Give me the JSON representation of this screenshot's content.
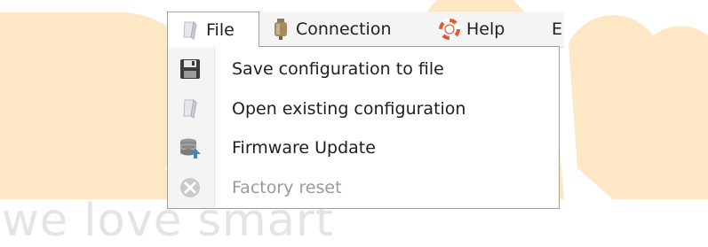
{
  "background": {
    "tagline": "we love smart",
    "logo_color": "#fde7c4",
    "tagline_color": "#e4e4e4"
  },
  "menubar": {
    "items": [
      {
        "label": "File",
        "icon": "file-icon"
      },
      {
        "label": "Connection",
        "icon": "connection-plug-icon"
      },
      {
        "label": "Help",
        "icon": "lifebuoy-icon"
      },
      {
        "label": "E",
        "icon": ""
      }
    ]
  },
  "file_menu": {
    "items": [
      {
        "label": "Save configuration to file",
        "icon": "floppy-disk-icon",
        "enabled": true
      },
      {
        "label": "Open existing configuration",
        "icon": "open-file-icon",
        "enabled": true
      },
      {
        "label": "Firmware Update",
        "icon": "database-upload-icon",
        "enabled": true
      },
      {
        "label": "Factory reset",
        "icon": "reset-icon",
        "enabled": false
      }
    ]
  }
}
